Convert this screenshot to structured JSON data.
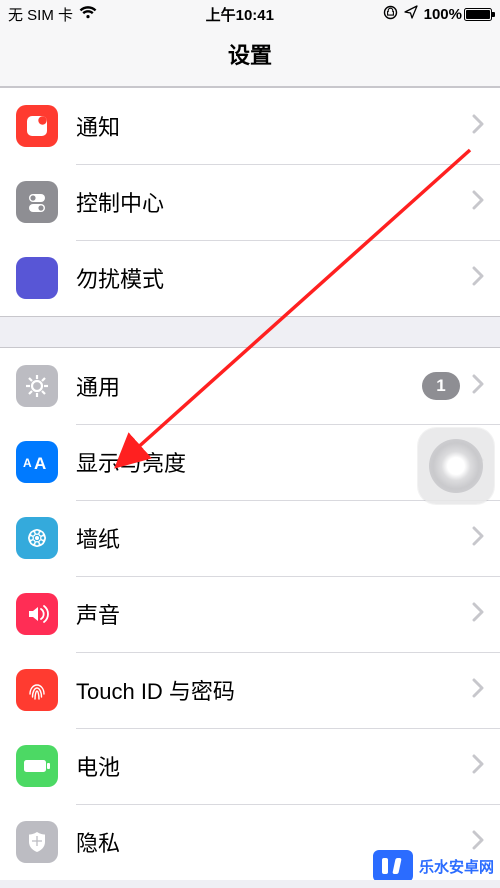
{
  "status": {
    "carrier": "无 SIM 卡",
    "time": "上午10:41",
    "battery_pct": "100%"
  },
  "nav": {
    "title": "设置"
  },
  "groups": [
    {
      "rows": [
        {
          "key": "notifications",
          "label": "通知"
        },
        {
          "key": "control-center",
          "label": "控制中心"
        },
        {
          "key": "dnd",
          "label": "勿扰模式"
        }
      ]
    },
    {
      "rows": [
        {
          "key": "general",
          "label": "通用",
          "badge": "1"
        },
        {
          "key": "display-brightness",
          "label": "显示与亮度"
        },
        {
          "key": "wallpaper",
          "label": "墙纸"
        },
        {
          "key": "sounds",
          "label": "声音"
        },
        {
          "key": "touchid-passcode",
          "label": "Touch ID 与密码"
        },
        {
          "key": "battery",
          "label": "电池"
        },
        {
          "key": "privacy",
          "label": "隐私"
        }
      ]
    }
  ],
  "watermark": {
    "text": "乐水安卓网"
  },
  "annotation": {
    "target_row": "display-brightness"
  }
}
